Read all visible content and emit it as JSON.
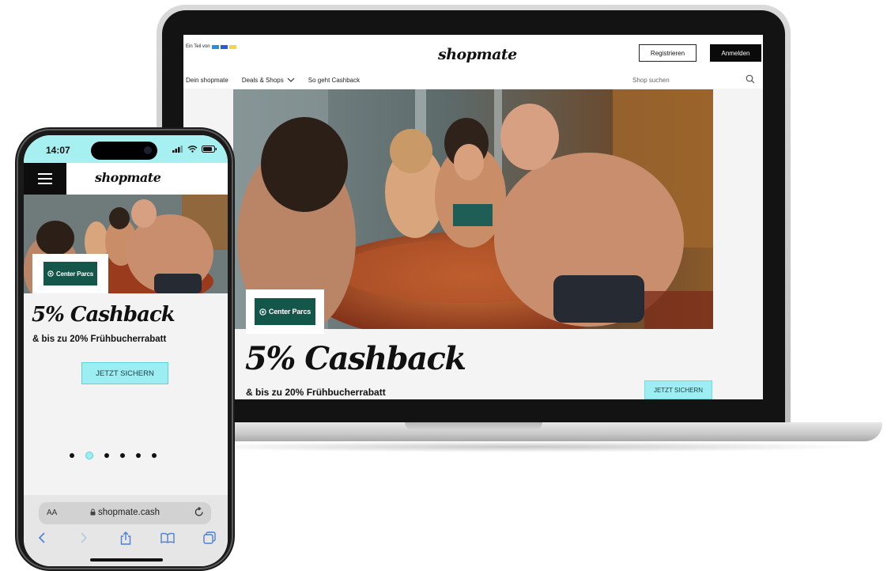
{
  "colors": {
    "accent_cta": "#9ceef2",
    "brand_center_parcs": "#14574a",
    "login_button": "#0a0a0a",
    "phone_status_bar": "#a6f0f1"
  },
  "desktop": {
    "part_of_label": "Ein Teil von",
    "logo": "shopmate",
    "register_label": "Registrieren",
    "login_label": "Anmelden",
    "nav": {
      "item1": "Dein shopmate",
      "item2": "Deals & Shops",
      "item3": "So geht Cashback"
    },
    "search_placeholder": "Shop suchen",
    "brand_label": "Center Parcs",
    "headline": "5% Cashback",
    "subheadline": "& bis zu 20% Frühbucherrabatt",
    "cta_label": "JETZT SICHERN"
  },
  "phone": {
    "time": "14:07",
    "logo": "shopmate",
    "brand_label": "Center Parcs",
    "headline": "5% Cashback",
    "subheadline": "& bis zu 20% Frühbucherrabatt",
    "cta_label": "JETZT SICHERN",
    "carousel": {
      "count": 6,
      "active": 2
    },
    "browser": {
      "aa_label": "AA",
      "url": "shopmate.cash"
    }
  },
  "icons": [
    "search-icon",
    "chevron-down-icon",
    "menu-icon",
    "lock-icon",
    "reload-icon",
    "back-icon",
    "forward-icon",
    "share-icon",
    "bookmarks-icon",
    "tabs-icon",
    "signal-icon",
    "wifi-icon",
    "battery-icon",
    "center-parcs-logo-icon"
  ]
}
